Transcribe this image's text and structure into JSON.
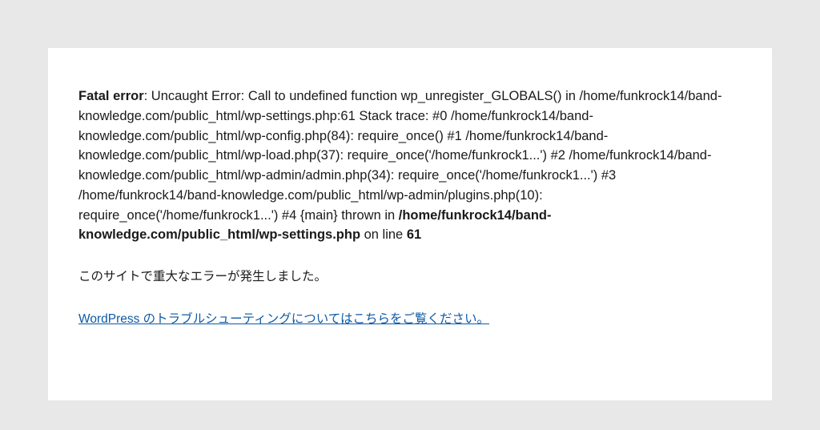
{
  "error": {
    "label": "Fatal error",
    "message_part1": ": Uncaught Error: Call to undefined function wp_unregister_GLOBALS() in /home/funkrock14/band-knowledge.com/public_html/wp-settings.php:61 Stack trace: #0 /home/funkrock14/band-knowledge.com/public_html/wp-config.php(84): require_once() #1 /home/funkrock14/band-knowledge.com/public_html/wp-load.php(37): require_once('/home/funkrock1...') #2 /home/funkrock14/band-knowledge.com/public_html/wp-admin/admin.php(34): require_once('/home/funkrock1...') #3 /home/funkrock14/band-knowledge.com/public_html/wp-admin/plugins.php(10): require_once('/home/funkrock1...') #4 {main} thrown in ",
    "thrown_in_path": "/home/funkrock14/band-knowledge.com/public_html/wp-settings.php",
    "message_part2": " on line ",
    "line_number": "61"
  },
  "notice": "このサイトで重大なエラーが発生しました。",
  "help_link": "WordPress のトラブルシューティングについてはこちらをご覧ください。"
}
